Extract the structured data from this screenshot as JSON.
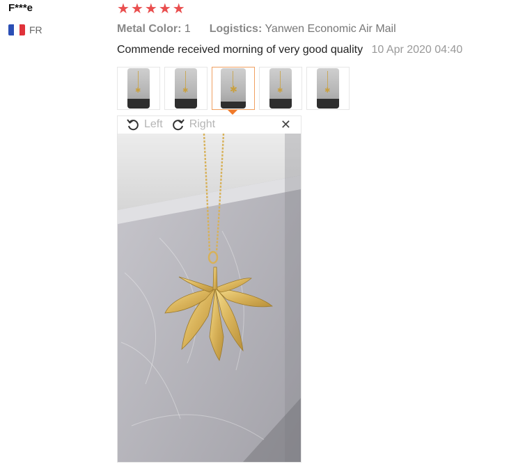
{
  "review": {
    "reviewer": "F***e",
    "country_code": "FR",
    "rating": 5,
    "star_color": "#e94e4e",
    "attributes": [
      {
        "label": "Metal Color:",
        "value": "1"
      },
      {
        "label": "Logistics:",
        "value": "Yanwen Economic Air Mail"
      }
    ],
    "text": "Commende received morning of very good quality",
    "date": "10 Apr 2020 04:40",
    "thumbnails_count": 5,
    "active_thumbnail": 3
  },
  "viewer": {
    "rotate_left_label": "Left",
    "rotate_right_label": "Right",
    "close_icon": "close-icon"
  },
  "colors": {
    "accent": "#f07a2a",
    "flag_blue": "#2b4fb5",
    "flag_white": "#ffffff",
    "flag_red": "#e0323a"
  }
}
